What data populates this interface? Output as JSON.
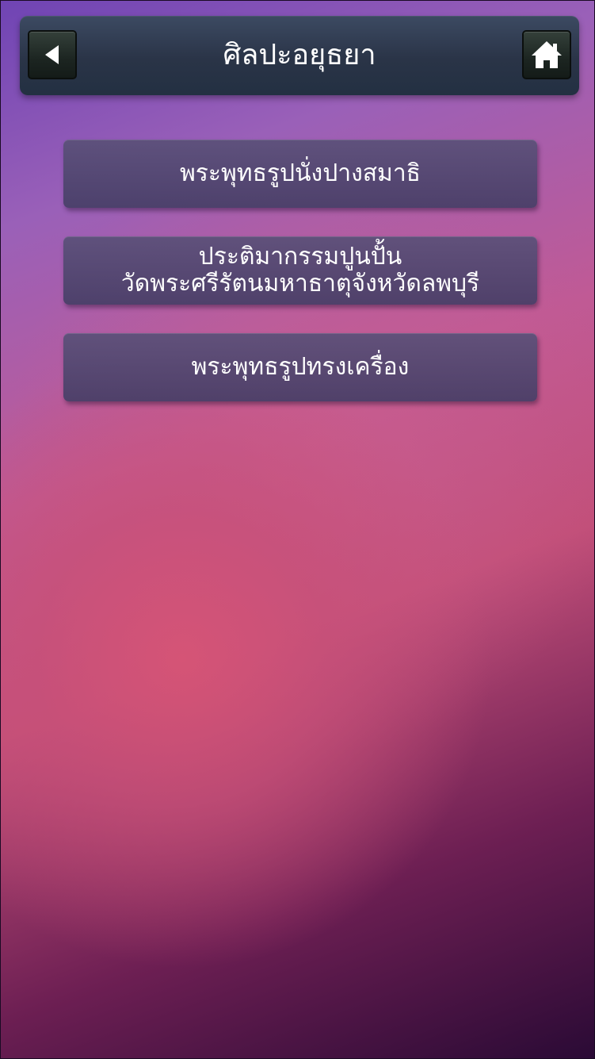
{
  "header": {
    "title": "ศิลปะอยุธยา",
    "back_icon": "triangle-left-icon",
    "home_icon": "home-icon"
  },
  "menu": {
    "items": [
      {
        "lines": [
          "พระพุทธรูปนั่งปางสมาธิ"
        ]
      },
      {
        "lines": [
          "ประติมากรรมปูนปั้น",
          "วัดพระศรีรัตนมหาธาตุจังหวัดลพบุรี"
        ]
      },
      {
        "lines": [
          "พระพุทธรูปทรงเครื่อง"
        ]
      }
    ]
  },
  "colors": {
    "header_bg": "#2a3447",
    "button_bg": "#4e4670",
    "text": "#ffffff"
  }
}
